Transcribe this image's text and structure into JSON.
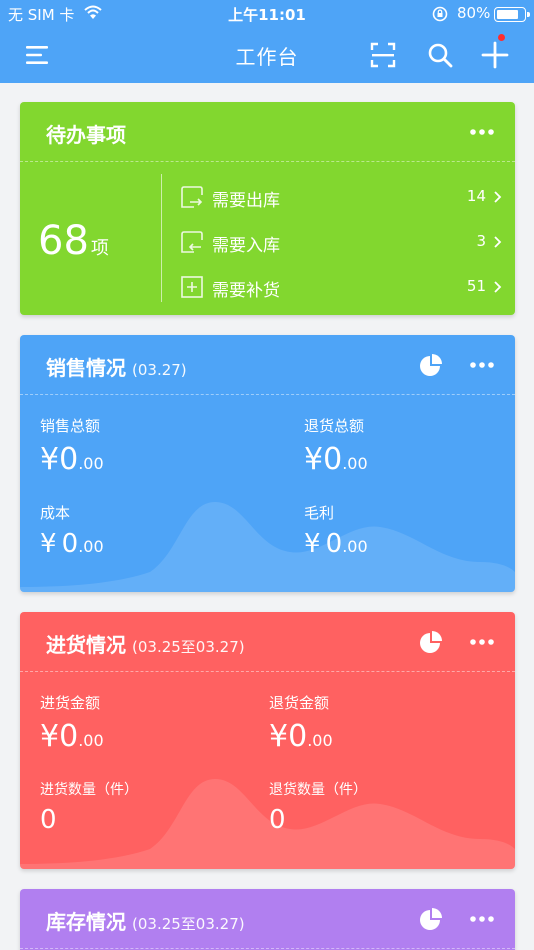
{
  "status_bar": {
    "carrier": "无 SIM 卡",
    "time": "上午11:01",
    "battery": "80%",
    "battery_level": 0.8
  },
  "navbar": {
    "title": "工作台",
    "icons": [
      "menu-icon",
      "scan-icon",
      "search-icon",
      "add-icon"
    ],
    "badge_color": "#ff2d2d"
  },
  "todo": {
    "title": "待办事项",
    "total": "68",
    "unit": "项",
    "color": "#82d72f",
    "items": [
      {
        "label": "需要出库",
        "count": "14",
        "icon": "outbound-box-icon"
      },
      {
        "label": "需要入库",
        "count": "3",
        "icon": "inbound-box-icon"
      },
      {
        "label": "需要补货",
        "count": "51",
        "icon": "restock-box-icon"
      }
    ]
  },
  "sales": {
    "title": "销售情况",
    "range": "(03.27)",
    "color": "#4ea4f7",
    "metrics": [
      {
        "label": "销售总额",
        "currency": "¥",
        "int": "0",
        "dec": ".00"
      },
      {
        "label": "退货总额",
        "currency": "¥",
        "int": "0",
        "dec": ".00"
      },
      {
        "label": "成本",
        "currency": "¥",
        "int": "0",
        "dec": ".00"
      },
      {
        "label": "毛利",
        "currency": "¥",
        "int": "0",
        "dec": ".00"
      }
    ]
  },
  "purchase": {
    "title": "进货情况",
    "range": "(03.25至03.27)",
    "color": "#ff6161",
    "metrics": [
      {
        "label": "进货金额",
        "currency": "¥",
        "int": "0",
        "dec": ".00"
      },
      {
        "label": "退货金额",
        "currency": "¥",
        "int": "0",
        "dec": ".00"
      },
      {
        "label": "进货数量（件）",
        "value": "0"
      },
      {
        "label": "退货数量（件）",
        "value": "0"
      }
    ]
  },
  "inventory": {
    "title": "库存情况",
    "range": "(03.25至03.27)",
    "color": "#b17ff0"
  }
}
